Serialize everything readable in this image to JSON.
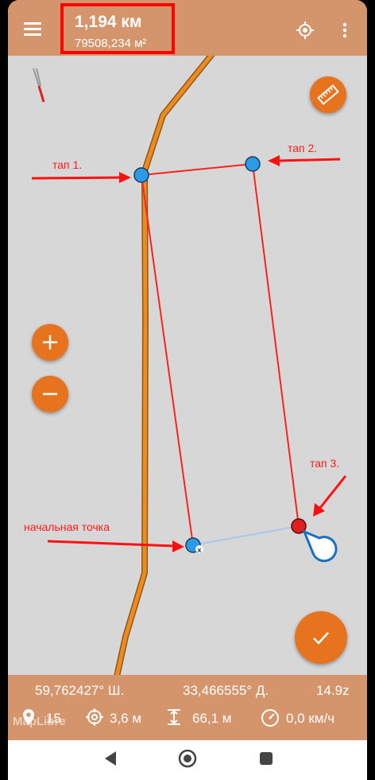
{
  "header": {
    "distance": "1,194 км",
    "area": "79508,234 м²"
  },
  "annotations": {
    "tap1": "тап 1.",
    "tap2": "тап 2.",
    "tap3": "тап 3.",
    "start": "начальная точка"
  },
  "status": {
    "latitude": "59,762427° Ш.",
    "longitude": "33,466555° Д.",
    "zoom": "14.9z",
    "satellites": "15",
    "accuracy": "3,6 м",
    "altitude": "66,1 м",
    "speed": "0,0 км/ч"
  },
  "attribution": "MapLibre",
  "colors": {
    "toolbar": "#d4956c",
    "accent": "#e8731f",
    "map_bg": "#d7d7d7",
    "measure_line": "#ff2020",
    "road": "#f08a1c",
    "highlight_box": "#ff0000"
  },
  "icons": [
    "menu-icon",
    "locate-icon",
    "more-vert-icon",
    "compass-icon",
    "ruler-icon",
    "plus-icon",
    "minus-icon",
    "check-icon",
    "pin-icon",
    "gps-accuracy-icon",
    "altitude-icon",
    "speedometer-icon"
  ]
}
